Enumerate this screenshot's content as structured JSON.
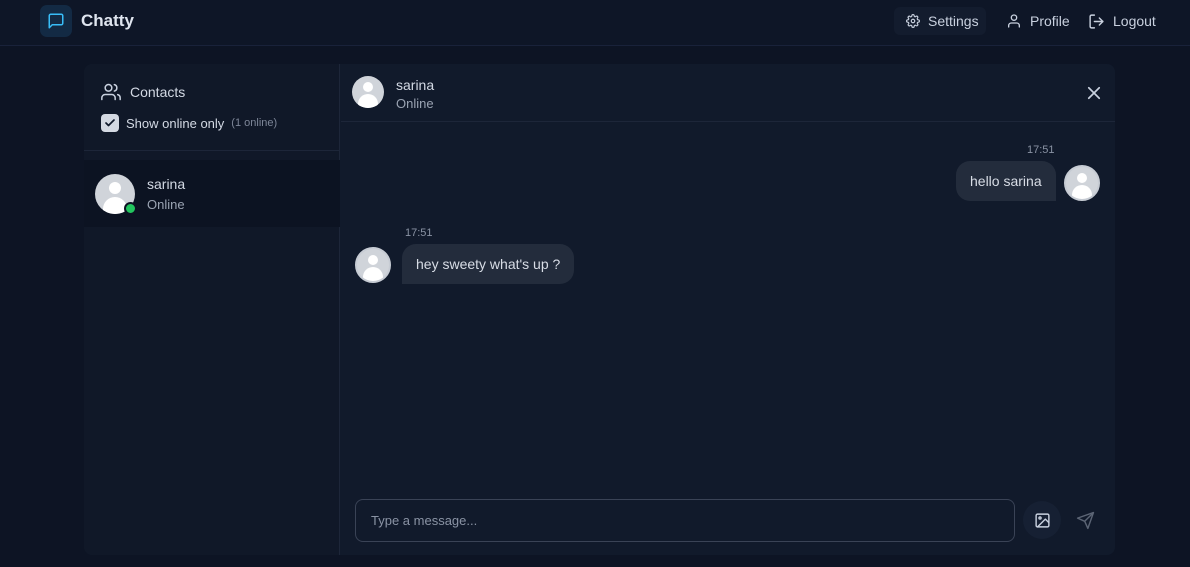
{
  "app": {
    "name": "Chatty"
  },
  "nav": {
    "settings": "Settings",
    "profile": "Profile",
    "logout": "Logout"
  },
  "sidebar": {
    "title": "Contacts",
    "filter_label": "Show online only",
    "filter_checked": true,
    "online_count": "(1 online)",
    "contacts": [
      {
        "name": "sarina",
        "status": "Online",
        "online": true
      }
    ]
  },
  "chat": {
    "header": {
      "name": "sarina",
      "status": "Online"
    },
    "messages": [
      {
        "direction": "outgoing",
        "time": "17:51",
        "text": "hello sarina"
      },
      {
        "direction": "incoming",
        "time": "17:51",
        "text": "hey sweety what's up ?"
      }
    ],
    "input": {
      "placeholder": "Type a message...",
      "value": ""
    }
  },
  "colors": {
    "accent": "#38bdf8",
    "online": "#22c55e",
    "background": "#0d1424",
    "bubble": "#232c3c"
  },
  "icons": [
    "message-square-icon",
    "gear-icon",
    "user-icon",
    "logout-icon",
    "users-icon",
    "check-icon",
    "close-icon",
    "image-icon",
    "send-icon"
  ]
}
